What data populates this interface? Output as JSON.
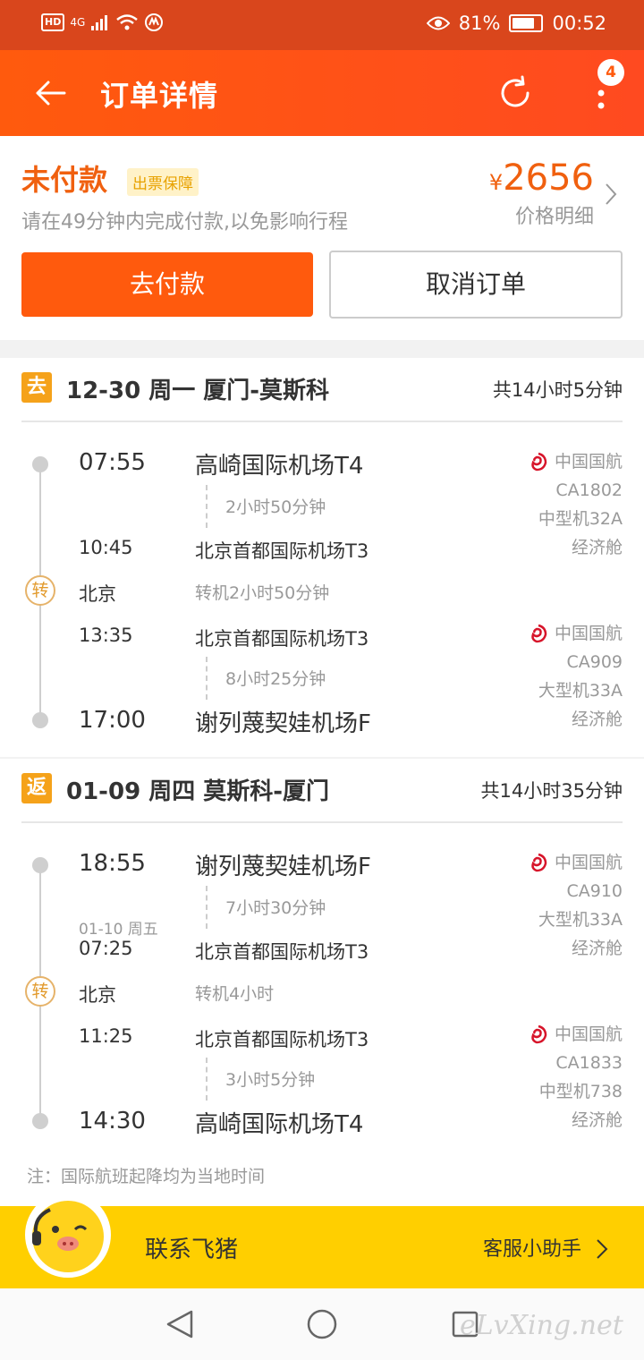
{
  "status_bar": {
    "hd": "HD",
    "net": "4G",
    "battery_pct": "81%",
    "battery_level": 0.81,
    "time": "00:52"
  },
  "header": {
    "title": "订单详情",
    "badge_count": "4"
  },
  "order": {
    "status": "未付款",
    "badge": "出票保障",
    "hint": "请在49分钟内完成付款,以免影响行程",
    "price_symbol": "¥",
    "price": "2656",
    "price_detail": "价格明细",
    "pay_label": "去付款",
    "cancel_label": "取消订单"
  },
  "outbound": {
    "dir": "去",
    "title": "12-30 周一 厦门-莫斯科",
    "total": "共14小时5分钟",
    "seg1": {
      "dep_time": "07:55",
      "dep_airport": "高崎国际机场T4",
      "duration": "2小时50分钟",
      "arr_time": "10:45",
      "arr_airport": "北京首都国际机场T3",
      "airline": "中国国航",
      "flight": "CA1802",
      "aircraft": "中型机32A",
      "cabin": "经济舱"
    },
    "transfer": {
      "icon": "转",
      "city": "北京",
      "note": "转机2小时50分钟"
    },
    "seg2": {
      "dep_time": "13:35",
      "dep_airport": "北京首都国际机场T3",
      "duration": "8小时25分钟",
      "arr_time": "17:00",
      "arr_airport": "谢列蔑契娃机场F",
      "airline": "中国国航",
      "flight": "CA909",
      "aircraft": "大型机33A",
      "cabin": "经济舱"
    }
  },
  "return": {
    "dir": "返",
    "title": "01-09 周四 莫斯科-厦门",
    "total": "共14小时35分钟",
    "seg1": {
      "dep_time": "18:55",
      "dep_airport": "谢列蔑契娃机场F",
      "duration": "7小时30分钟",
      "next_date": "01-10 周五",
      "arr_time": "07:25",
      "arr_airport": "北京首都国际机场T3",
      "airline": "中国国航",
      "flight": "CA910",
      "aircraft": "大型机33A",
      "cabin": "经济舱"
    },
    "transfer": {
      "icon": "转",
      "city": "北京",
      "note": "转机4小时"
    },
    "seg2": {
      "dep_time": "11:25",
      "dep_airport": "北京首都国际机场T3",
      "duration": "3小时5分钟",
      "arr_time": "14:30",
      "arr_airport": "高崎国际机场T4",
      "airline": "中国国航",
      "flight": "CA1833",
      "aircraft": "中型机738",
      "cabin": "经济舱"
    }
  },
  "note": "注：国际航班起降均为当地时间",
  "contact": {
    "label": "联系飞猪",
    "service": "客服小助手"
  },
  "watermark": "eLvXing.net",
  "colors": {
    "accent": "#ff5a0d",
    "status_bar": "#d9461c",
    "contact_bg": "#ffcf00",
    "badge": "#f5a21a"
  }
}
